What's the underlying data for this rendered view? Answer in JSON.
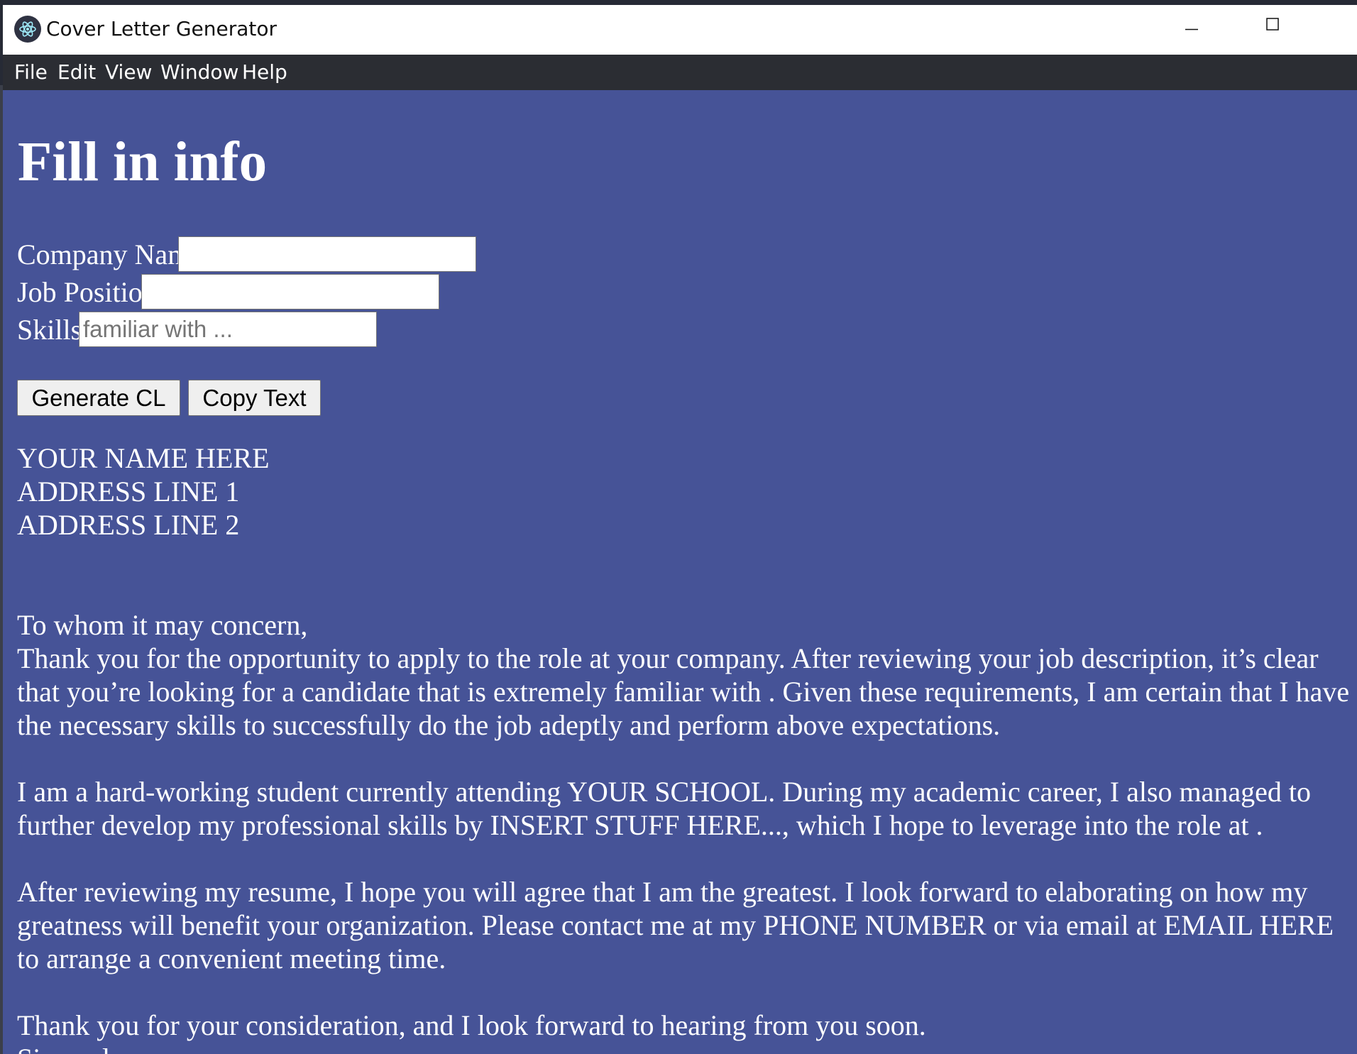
{
  "window": {
    "title": "Cover Letter Generator",
    "controls": [
      "minimize-icon",
      "maximize-icon",
      "close-icon"
    ]
  },
  "menu": {
    "items": [
      "File",
      "Edit",
      "View",
      "Window",
      "Help"
    ]
  },
  "form": {
    "heading": "Fill in info",
    "company_label": "Company Name:",
    "company_value": "",
    "position_label": "Job Position:",
    "position_value": "",
    "skills_label": "Skills:",
    "skills_value": "",
    "skills_placeholder": "familiar with ..."
  },
  "buttons": {
    "generate": "Generate CL",
    "copy": "Copy Text"
  },
  "letter": {
    "header_lines": [
      "YOUR NAME HERE",
      "ADDRESS LINE 1",
      "ADDRESS LINE 2"
    ],
    "greeting": "To whom it may concern,",
    "paragraph_1": "Thank you for the opportunity to apply to the role at your company. After reviewing your job description, it’s clear that you’re looking for a candidate that is extremely familiar with . Given these requirements, I am certain that I have the necessary skills to successfully do the job adeptly and perform above expectations.",
    "paragraph_2": "I am a hard-working student currently attending YOUR SCHOOL. During my academic career, I also managed to further develop my professional skills by INSERT STUFF HERE..., which I hope to leverage into the role at .",
    "paragraph_3": "After reviewing my resume, I hope you will agree that I am the greatest. I look forward to elaborating on how my greatness will benefit your organization. Please contact me at my PHONE NUMBER or via email at EMAIL HERE to arrange a convenient meeting time.",
    "paragraph_4": "Thank you for your consideration, and I look forward to hearing from you soon.",
    "closing": "Sincerely,"
  },
  "colors": {
    "background": "#465397",
    "menubar": "#2b2d33",
    "titlebar": "#ffffff",
    "text": "#ffffff"
  }
}
